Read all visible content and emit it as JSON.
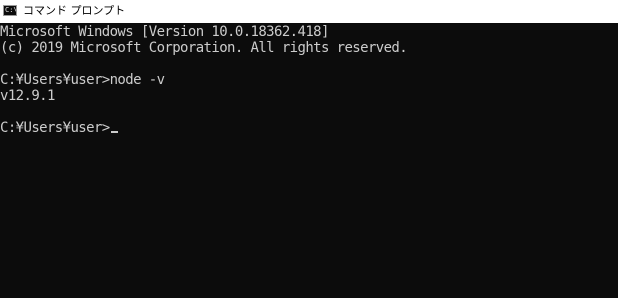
{
  "window": {
    "title": "コマンド プロンプト",
    "icon": "cmd-icon"
  },
  "console": {
    "lines": [
      "Microsoft Windows [Version 10.0.18362.418]",
      "(c) 2019 Microsoft Corporation. All rights reserved.",
      "",
      "C:¥Users¥user>node -v",
      "v12.9.1",
      "",
      "C:¥Users¥user>"
    ]
  },
  "colors": {
    "background": "#0c0c0c",
    "text": "#cccccc",
    "titlebar": "#ffffff"
  }
}
